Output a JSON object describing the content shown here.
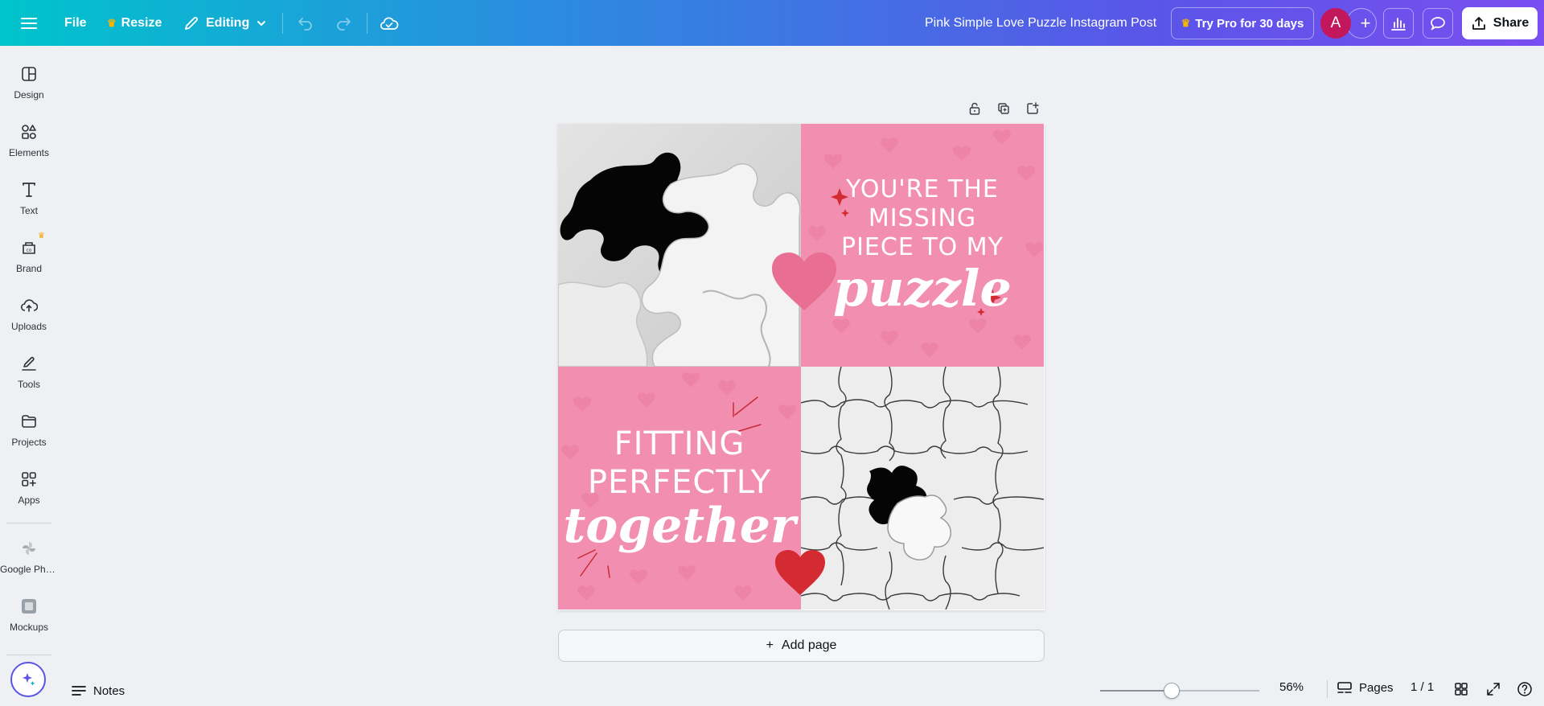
{
  "topbar": {
    "file_label": "File",
    "resize_label": "Resize",
    "editing_label": "Editing",
    "doc_title": "Pink Simple Love Puzzle Instagram Post",
    "try_pro_label": "Try Pro for 30 days",
    "avatar_letter": "A",
    "share_label": "Share"
  },
  "sidebar": {
    "items": [
      {
        "label": "Design",
        "icon": "design-icon"
      },
      {
        "label": "Elements",
        "icon": "elements-icon"
      },
      {
        "label": "Text",
        "icon": "text-icon"
      },
      {
        "label": "Brand",
        "icon": "brand-icon"
      },
      {
        "label": "Uploads",
        "icon": "uploads-icon"
      },
      {
        "label": "Tools",
        "icon": "tools-icon"
      },
      {
        "label": "Projects",
        "icon": "projects-icon"
      },
      {
        "label": "Apps",
        "icon": "apps-icon"
      },
      {
        "label": "Google Pho...",
        "icon": "google-photos-icon"
      },
      {
        "label": "Mockups",
        "icon": "mockups-icon"
      }
    ]
  },
  "design": {
    "top_right_lines": [
      "YOU'RE THE",
      "MISSING",
      "PIECE TO MY"
    ],
    "top_right_script": "puzzle",
    "bottom_left_lines": [
      "FITTING",
      "PERFECTLY"
    ],
    "bottom_left_script": "together"
  },
  "canvas": {
    "add_page_label": "Add page"
  },
  "bottombar": {
    "notes_label": "Notes",
    "zoom_level": "56%",
    "zoom_fraction": 0.45,
    "pages_label": "Pages",
    "page_count": "1 / 1"
  },
  "colors": {
    "accent": "#5a55e8",
    "brand_pink": "#f28fb1",
    "avatar": "#c2185b",
    "heart_red": "#d42b32",
    "heart_pink": "#e86f93"
  }
}
